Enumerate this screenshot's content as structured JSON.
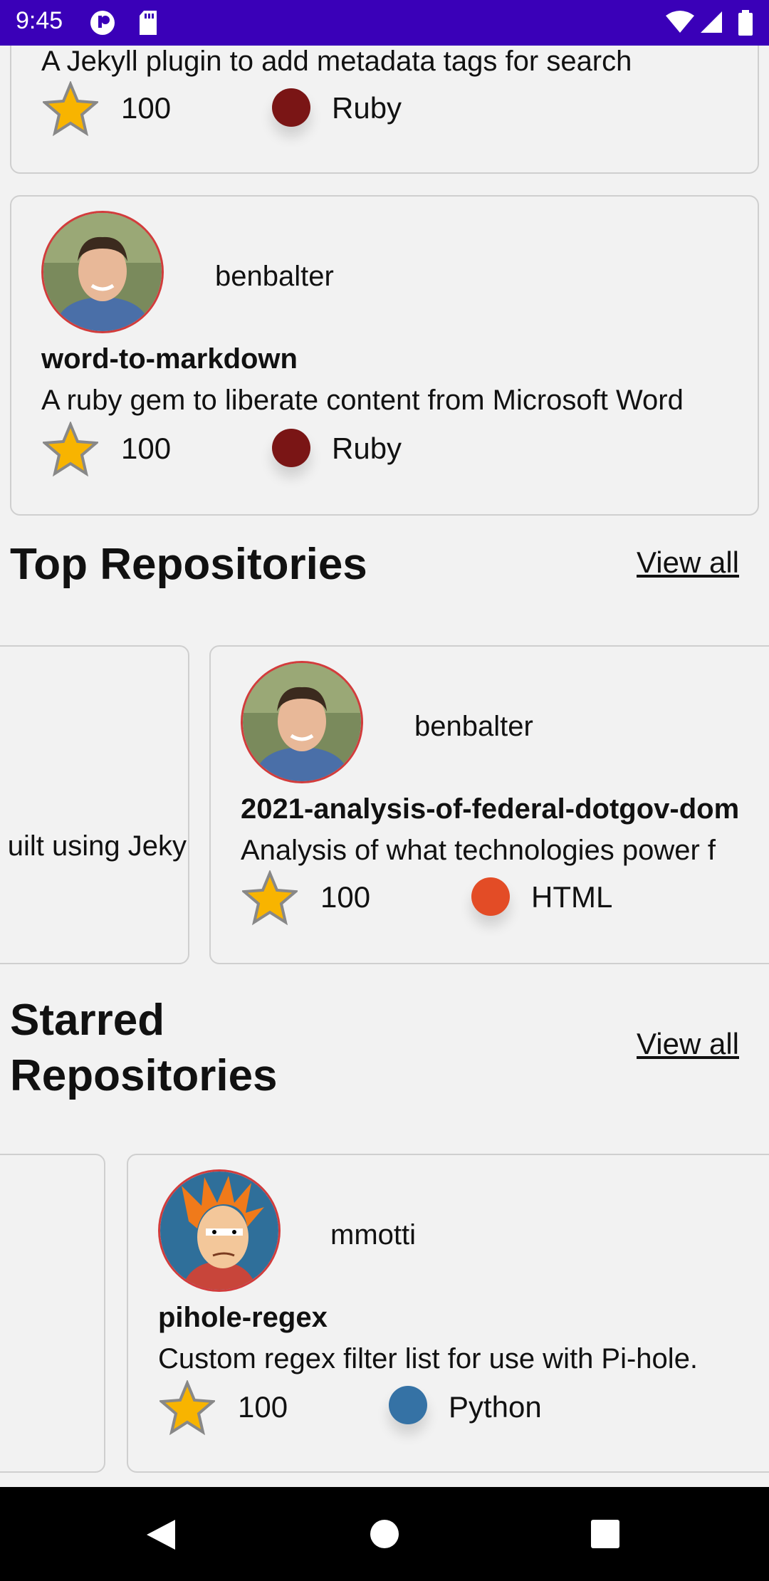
{
  "status_bar": {
    "time": "9:45"
  },
  "cards_top": [
    {
      "description": "A Jekyll plugin to add metadata tags for search",
      "stars": "100",
      "language": "Ruby",
      "language_color": "#7a1515"
    },
    {
      "owner": "benbalter",
      "name": "word-to-markdown",
      "description": "A ruby gem to liberate content from Microsoft Word",
      "stars": "100",
      "language": "Ruby",
      "language_color": "#7a1515"
    }
  ],
  "top_repositories": {
    "title": "Top Repositories",
    "view_all": "View all",
    "partial_card_text": "uilt using Jeky",
    "card": {
      "owner": "benbalter",
      "name": "2021-analysis-of-federal-dotgov-dom",
      "description": "Analysis of what technologies power f",
      "stars": "100",
      "language": "HTML",
      "language_color": "#e34c26"
    }
  },
  "starred_repositories": {
    "title_line1": "Starred",
    "title_line2": "Repositories",
    "view_all": "View all",
    "card": {
      "owner": "mmotti",
      "name": "pihole-regex",
      "description": "Custom regex filter list for use with Pi-hole.",
      "stars": "100",
      "language": "Python",
      "language_color": "#3572a5"
    }
  },
  "colors": {
    "status_bar": "#3a00b8",
    "avatar_border": "#d23c3c"
  }
}
